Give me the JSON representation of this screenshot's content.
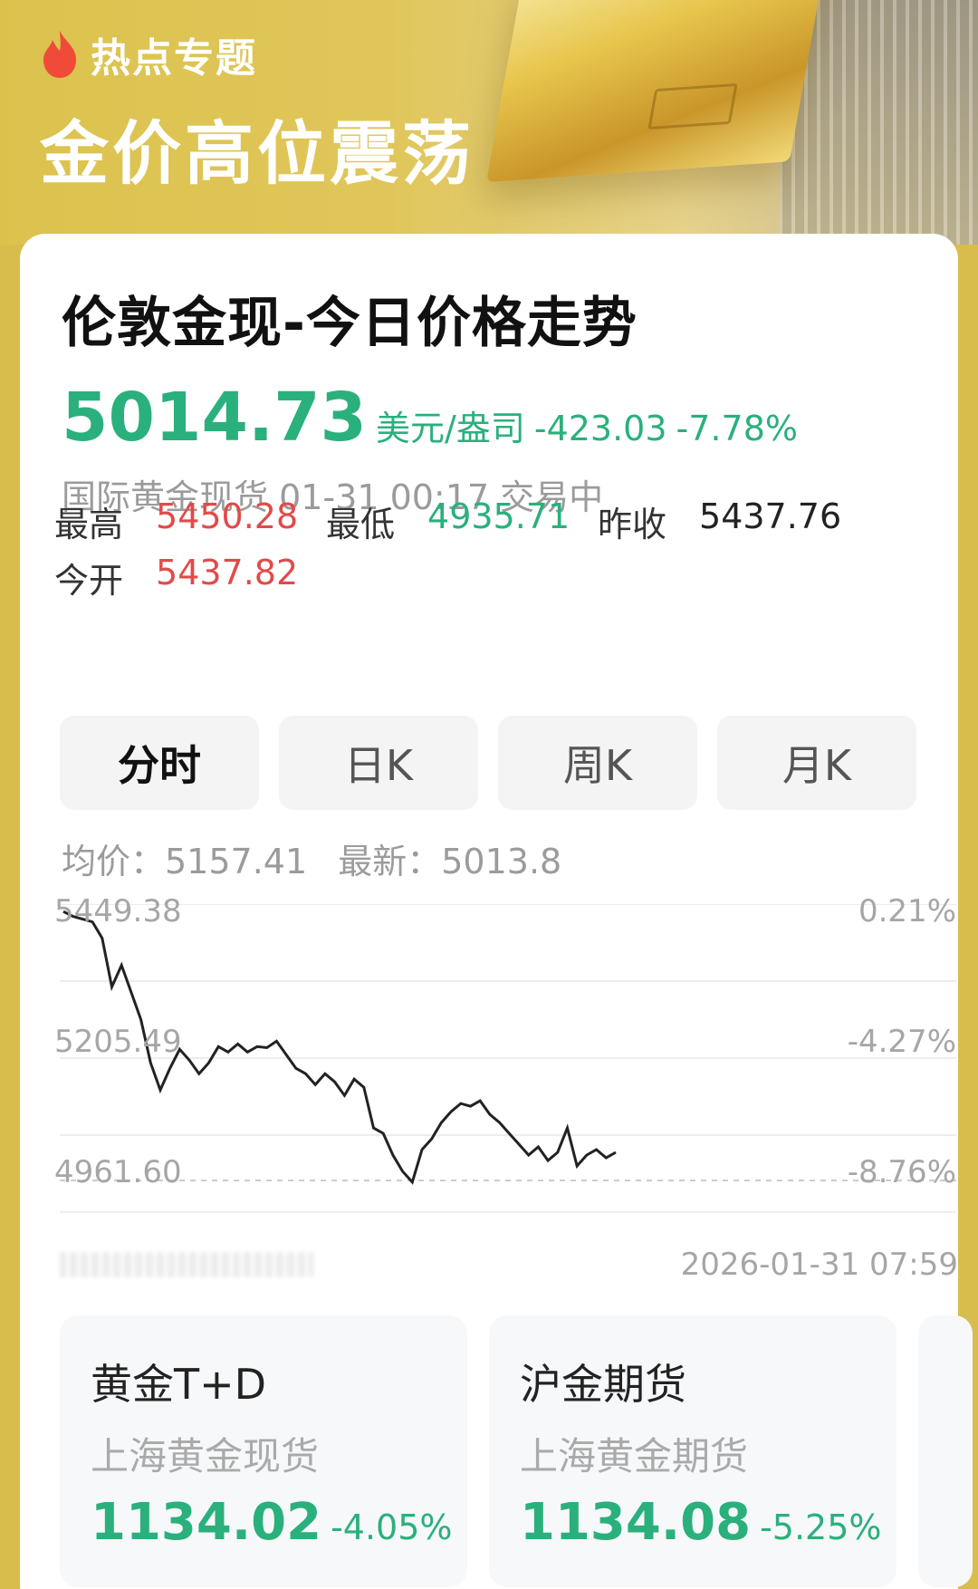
{
  "banner": {
    "hot_label": "热点专题",
    "title": "金价高位震荡"
  },
  "card": {
    "title": "伦敦金现-今日价格走势",
    "price": "5014.73",
    "unit": "美元/盎司",
    "change": "-423.03",
    "change_pct": "-7.78%",
    "sub_info": "国际黄金现货 01-31 00:17 交易中",
    "stats": {
      "high_label": "最高",
      "high_value": "5450.28",
      "low_label": "最低",
      "low_value": "4935.71",
      "prev_close_label": "昨收",
      "prev_close_value": "5437.76",
      "open_label": "今开",
      "open_value": "5437.82"
    },
    "tabs": [
      "分时",
      "日K",
      "周K",
      "月K"
    ],
    "active_tab": 0,
    "avg_text": "均价：5157.41",
    "latest_text": "最新：5013.8"
  },
  "chart_data": {
    "type": "line",
    "y_labels_left": [
      "5449.38",
      "5205.49",
      "4961.60"
    ],
    "y_labels_right": [
      "0.21%",
      "-4.27%",
      "-8.76%"
    ],
    "x_label_right": "2026-01-31 07:59",
    "ylim": [
      4961.6,
      5449.38
    ],
    "series": [
      {
        "values": [
          5449,
          5440,
          5435,
          5430,
          5400,
          5310,
          5350,
          5300,
          5250,
          5170,
          5120,
          5160,
          5195,
          5175,
          5150,
          5170,
          5200,
          5190,
          5205,
          5190,
          5200,
          5198,
          5210,
          5185,
          5160,
          5150,
          5130,
          5150,
          5135,
          5110,
          5140,
          5125,
          5050,
          5040,
          5000,
          4970,
          4950,
          5010,
          5030,
          5060,
          5080,
          5095,
          5090,
          5100,
          5075,
          5060,
          5040,
          5020,
          5000,
          5015,
          4990,
          5005,
          5050,
          4980,
          5000,
          5010,
          4995,
          5005
        ]
      }
    ]
  },
  "markets": [
    {
      "title": "黄金T+D",
      "sub": "上海黄金现货",
      "value": "1134.02",
      "pct": "-4.05%"
    },
    {
      "title": "沪金期货",
      "sub": "上海黄金期货",
      "value": "1134.08",
      "pct": "-5.25%"
    }
  ],
  "colors": {
    "up": "#e24a4a",
    "down": "#2ab07c",
    "banner": "#d9bd4c"
  }
}
